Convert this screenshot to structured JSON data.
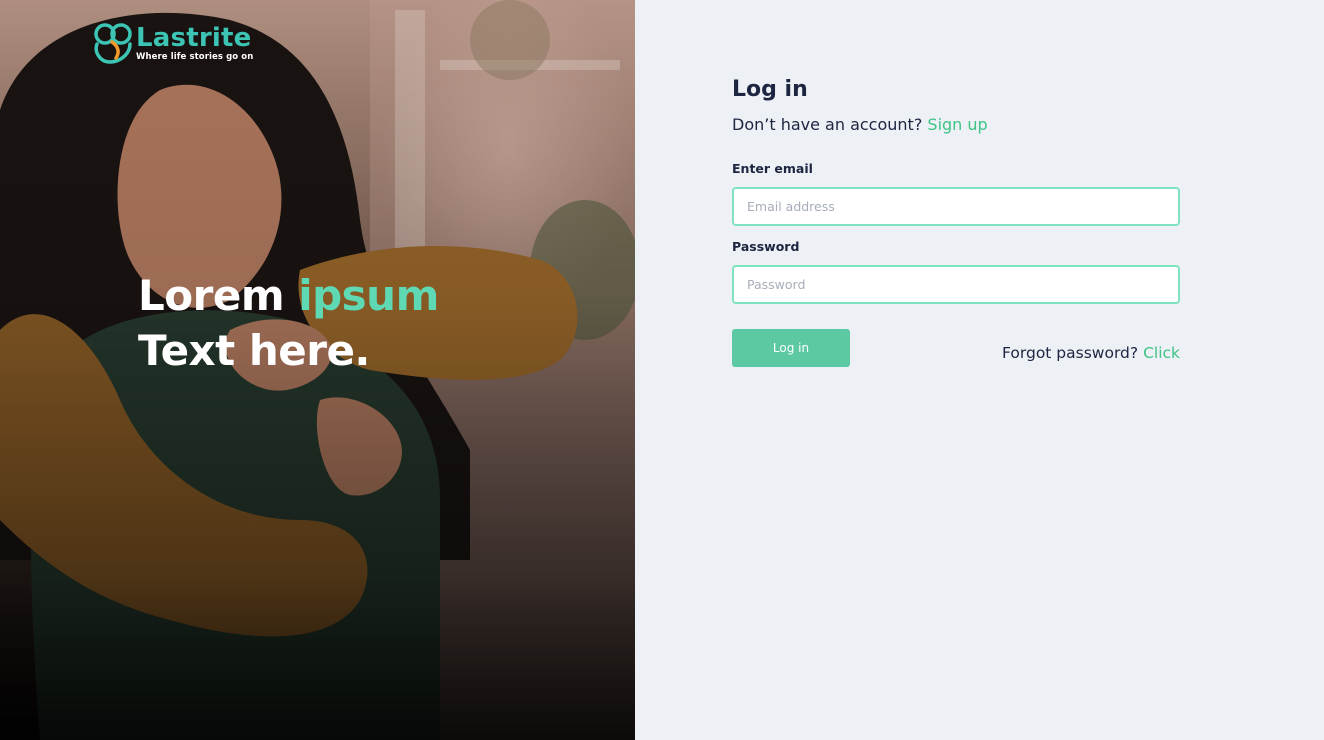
{
  "brand": {
    "name": "Lastrite",
    "tagline": "Where life stories go on",
    "colors": {
      "teal": "#3cc4b4",
      "orange": "#f39a2b",
      "accent_green": "#3ec486",
      "button": "#5dc9a3"
    }
  },
  "hero": {
    "headline_word1": "Lorem",
    "headline_word2": "ipsum",
    "headline_line2": "Text here."
  },
  "login": {
    "title": "Log in",
    "no_account_text": "Don’t have an account?",
    "signup_link": "Sign up",
    "email_label": "Enter email",
    "email_placeholder": "Email address",
    "email_value": "",
    "password_label": "Password",
    "password_placeholder": "Password",
    "password_value": "",
    "submit_label": "Log in",
    "forgot_text": "Forgot password?",
    "forgot_link": "Click"
  }
}
